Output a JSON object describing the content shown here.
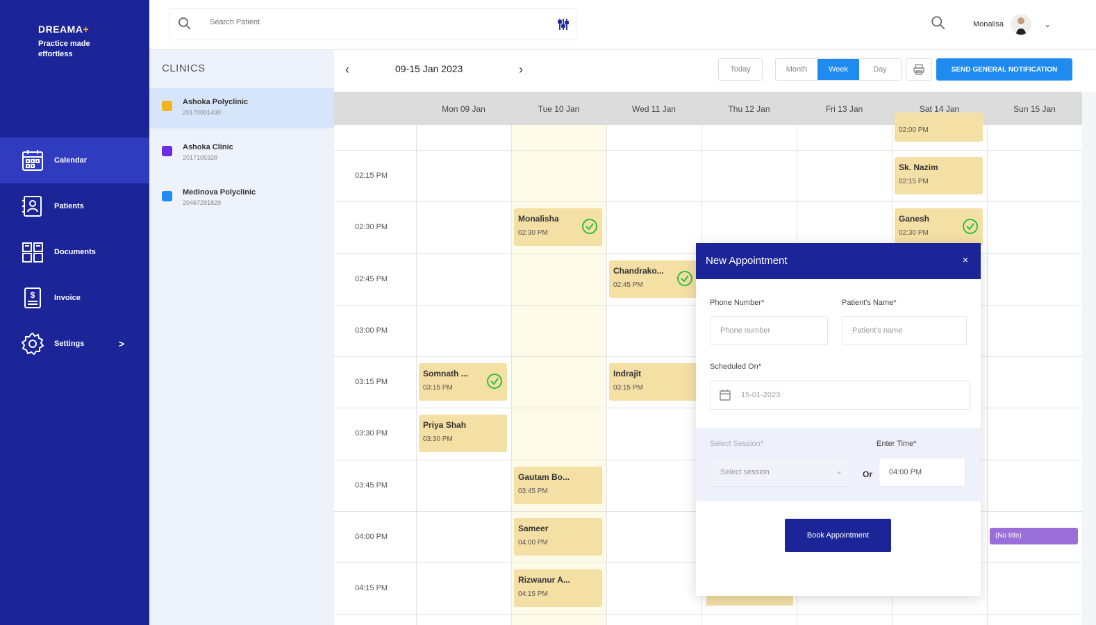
{
  "brand": {
    "logo_main": "DREAMA",
    "logo_plus": "+",
    "tagline": "Practice made effortless"
  },
  "sidebar": {
    "items": [
      {
        "label": "Calendar",
        "icon": "calendar-icon",
        "active": true
      },
      {
        "label": "Patients",
        "icon": "patients-icon"
      },
      {
        "label": "Documents",
        "icon": "documents-icon"
      },
      {
        "label": "Invoice",
        "icon": "invoice-icon"
      },
      {
        "label": "Settings",
        "icon": "gear-icon",
        "chevron": ">"
      }
    ]
  },
  "topbar": {
    "search_placeholder": "Search Patient",
    "user_name": "Monalisa",
    "caret": "⌄"
  },
  "clinics": {
    "title": "CLINICS",
    "items": [
      {
        "name": "Ashoka Polyclinic",
        "code": "20170001490",
        "color": "#f5b31b"
      },
      {
        "name": "Ashoka Clinic",
        "code": "2017105328",
        "color": "#6a2ee8"
      },
      {
        "name": "Medinova Polyclinic",
        "code": "20467291829",
        "color": "#1f8af0"
      }
    ]
  },
  "calendar": {
    "prev": "‹",
    "next": "›",
    "range": "09-15 Jan 2023",
    "today_label": "Today",
    "views": [
      "Month",
      "Week",
      "Day"
    ],
    "selected_view": "Week",
    "notify_label": "SEND GENERAL NOTIFICATION",
    "days": [
      "Mon 09 Jan",
      "Tue 10 Jan",
      "Wed 11 Jan",
      "Thu 12 Jan",
      "Fri 13 Jan",
      "Sat 14 Jan",
      "Sun 15 Jan"
    ],
    "times": [
      "02:15 PM",
      "02:30 PM",
      "02:45 PM",
      "03:00 PM",
      "03:15 PM",
      "03:30 PM",
      "03:45 PM",
      "04:00 PM",
      "04:15 PM"
    ],
    "appointments": [
      {
        "name": "",
        "time": "02:00 PM",
        "checked": false
      },
      {
        "name": "Sk. Nazim",
        "time": "02:15 PM",
        "checked": false
      },
      {
        "name": "Monalisha",
        "time": "02:30 PM",
        "checked": true
      },
      {
        "name": "Ganesh",
        "time": "02:30 PM",
        "checked": true
      },
      {
        "name": "Chandrako...",
        "time": "02:45 PM",
        "checked": true
      },
      {
        "name": "Somnath ...",
        "time": "03:15 PM",
        "checked": true
      },
      {
        "name": "Indrajit",
        "time": "03:15 PM",
        "checked": false
      },
      {
        "name": "Priya Shah",
        "time": "03:30 PM",
        "checked": false
      },
      {
        "name": "Gautam Bo...",
        "time": "03:45 PM",
        "checked": false
      },
      {
        "name": "Sameer",
        "time": "04:00 PM",
        "checked": false
      },
      {
        "name": "Rizwanur A...",
        "time": "04:15 PM",
        "checked": false
      }
    ],
    "no_title_event": "(No title)"
  },
  "modal": {
    "title": "New Appointment",
    "close": "×",
    "phone_label": "Phone Number*",
    "phone_placeholder": "Phone number",
    "patient_label": "Patient's Name*",
    "patient_placeholder": "Patient's name",
    "scheduled_label": "Scheduled On*",
    "scheduled_value": "15-01-2023",
    "session_label": "Select Session*",
    "session_placeholder": "Select session",
    "or_label": "Or",
    "time_label": "Enter Time*",
    "time_value": "04:00 PM",
    "book_label": "Book Appointment"
  }
}
